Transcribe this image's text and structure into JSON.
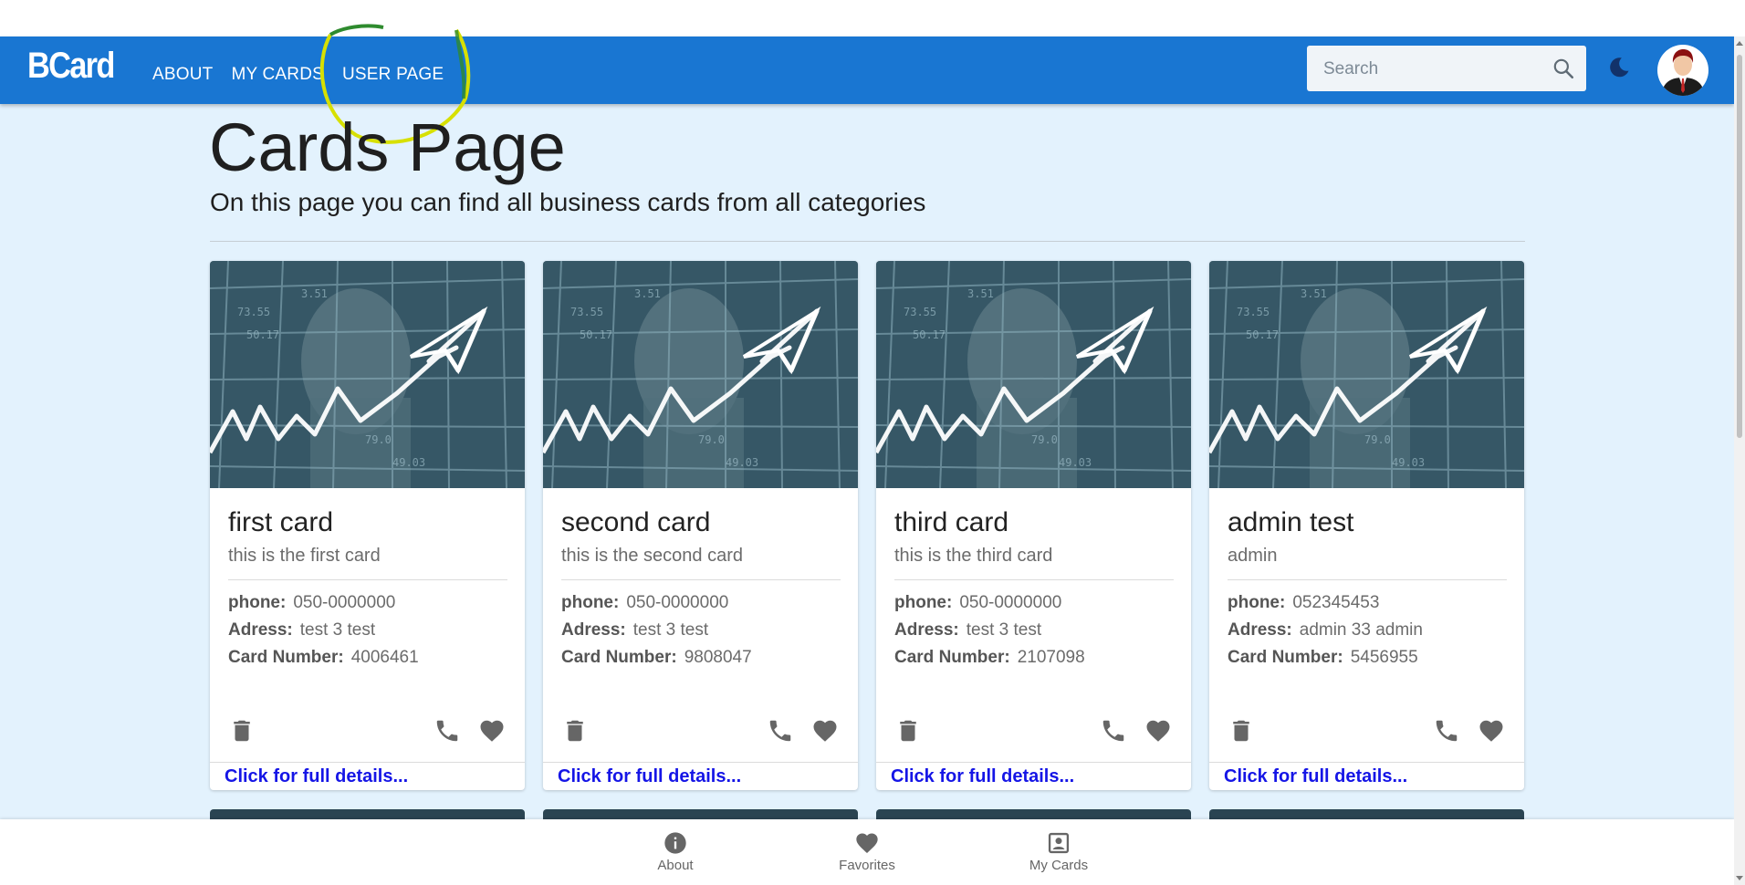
{
  "app": {
    "logo": "BCard"
  },
  "nav": {
    "about": "ABOUT",
    "my_cards": "MY CARDS",
    "user_page": "USER PAGE"
  },
  "search": {
    "placeholder": "Search"
  },
  "icons": {
    "search": "search-icon",
    "theme": "dark-mode-icon",
    "avatar": "avatar",
    "delete": "trash-icon",
    "phone": "phone-icon",
    "favorite": "heart-icon",
    "about": "info-icon",
    "favorites": "heart-icon",
    "my_cards": "contact-card-icon"
  },
  "colors": {
    "appbar": "#1976d2",
    "background": "#e3f2fd",
    "link": "#1515e6"
  },
  "page": {
    "title": "Cards Page",
    "subtitle": "On this page you can find all business cards from all categories"
  },
  "labels": {
    "phone": "phone:",
    "address": "Adress:",
    "card_number": "Card Number:",
    "details": "Click for full details..."
  },
  "cards": [
    {
      "title": "first card",
      "subtitle": "this is the first card",
      "phone": "050-0000000",
      "address": "test 3 test",
      "card_number": "4006461"
    },
    {
      "title": "second card",
      "subtitle": "this is the second card",
      "phone": "050-0000000",
      "address": "test 3 test",
      "card_number": "9808047"
    },
    {
      "title": "third card",
      "subtitle": "this is the third card",
      "phone": "050-0000000",
      "address": "test 3 test",
      "card_number": "2107098"
    },
    {
      "title": "admin test",
      "subtitle": "admin",
      "phone": "052345453",
      "address": "admin 33 admin",
      "card_number": "5456955"
    }
  ],
  "bottom_nav": {
    "about": "About",
    "favorites": "Favorites",
    "my_cards": "My Cards"
  }
}
